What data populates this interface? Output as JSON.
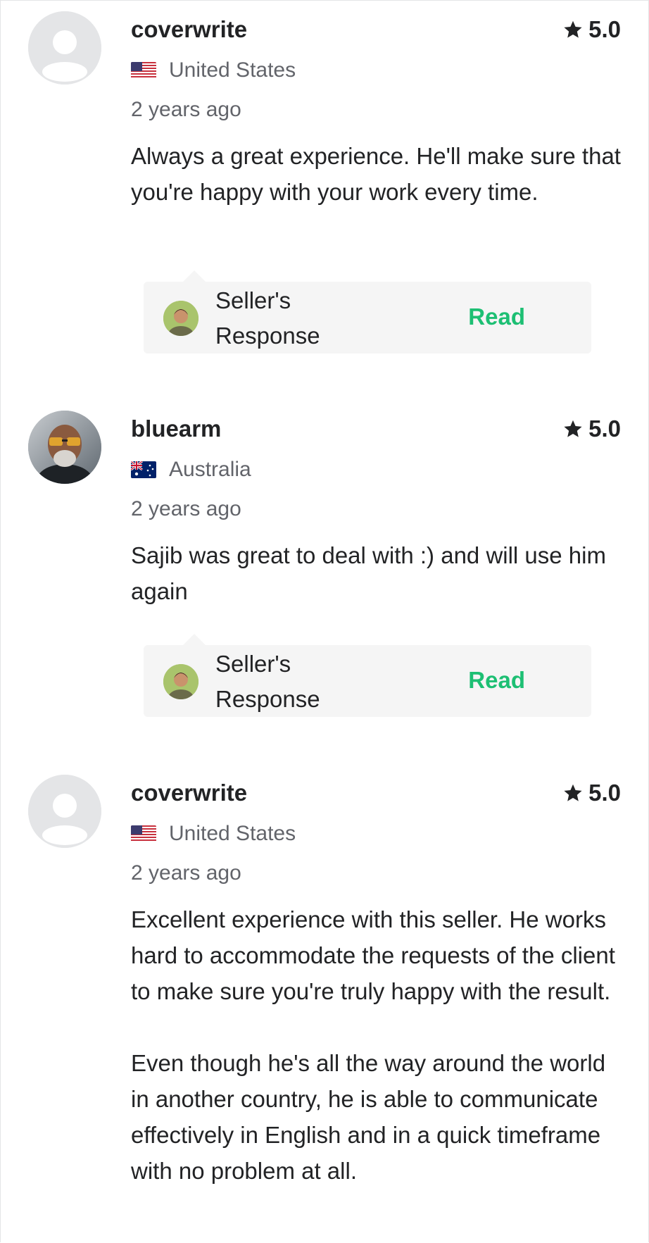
{
  "reviews": [
    {
      "username": "coverwrite",
      "country": "United States",
      "flag": "us-flag",
      "time": "2 years ago",
      "rating": "5.0",
      "avatar": "default-avatar",
      "body": [
        "Always a great experience. He'll make sure that you're happy with your work every time."
      ],
      "response": {
        "label_line1": "Seller's",
        "label_line2": "Response",
        "action": "Read"
      }
    },
    {
      "username": "bluearm",
      "country": "Australia",
      "flag": "au-flag",
      "time": "2 years ago",
      "rating": "5.0",
      "avatar": "photo-avatar",
      "body": [
        "Sajib was great to deal with :) and will use him again"
      ],
      "response": {
        "label_line1": "Seller's",
        "label_line2": "Response",
        "action": "Read"
      }
    },
    {
      "username": "coverwrite",
      "country": "United States",
      "flag": "us-flag",
      "time": "2 years ago",
      "rating": "5.0",
      "avatar": "default-avatar",
      "body": [
        "Excellent experience with this seller. He works hard to accommodate the requests of the client to make sure you're truly happy with the result.",
        "Even though he's all the way around the world in another country, he is able to communicate effectively in English and in a quick timeframe with no problem at all."
      ]
    }
  ],
  "colors": {
    "accent_green": "#1dbf73",
    "text_primary": "#222325",
    "text_secondary": "#62646a",
    "response_bg": "#f5f5f5"
  }
}
